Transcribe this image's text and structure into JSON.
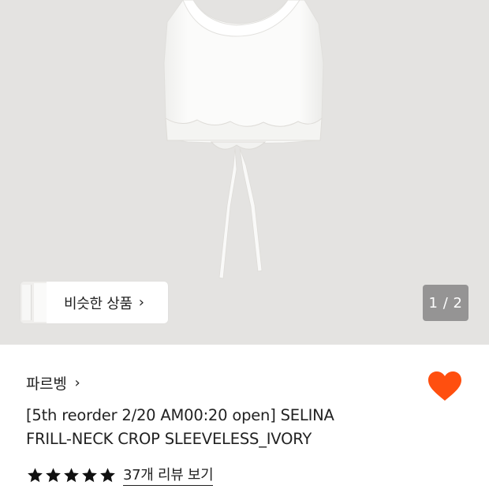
{
  "product_image": {
    "alt": "",
    "pager": {
      "current": "1",
      "separator": "/",
      "total": "2",
      "text": "1 / 2"
    },
    "similar_button": {
      "label": "비슷한 상품",
      "chevron": "›"
    }
  },
  "product_info": {
    "brand": {
      "name": "파르벵",
      "chevron": "›"
    },
    "title_lines": [
      "[5th reorder 2/20 AM00:20 open] SELINA",
      "FRILL-NECK CROP SLEEVELESS_IVORY"
    ],
    "wishlist": {
      "icon": "heart-icon",
      "color": "#ff4f0f",
      "active": true
    },
    "rating": {
      "stars": 5,
      "max": 5,
      "review_link": "37개 리뷰 보기"
    }
  },
  "colors": {
    "hero_background": "#e4e3e1",
    "garment": "#f8f8f6",
    "pager_background": "#959494",
    "accent": "#ff4f0f"
  }
}
